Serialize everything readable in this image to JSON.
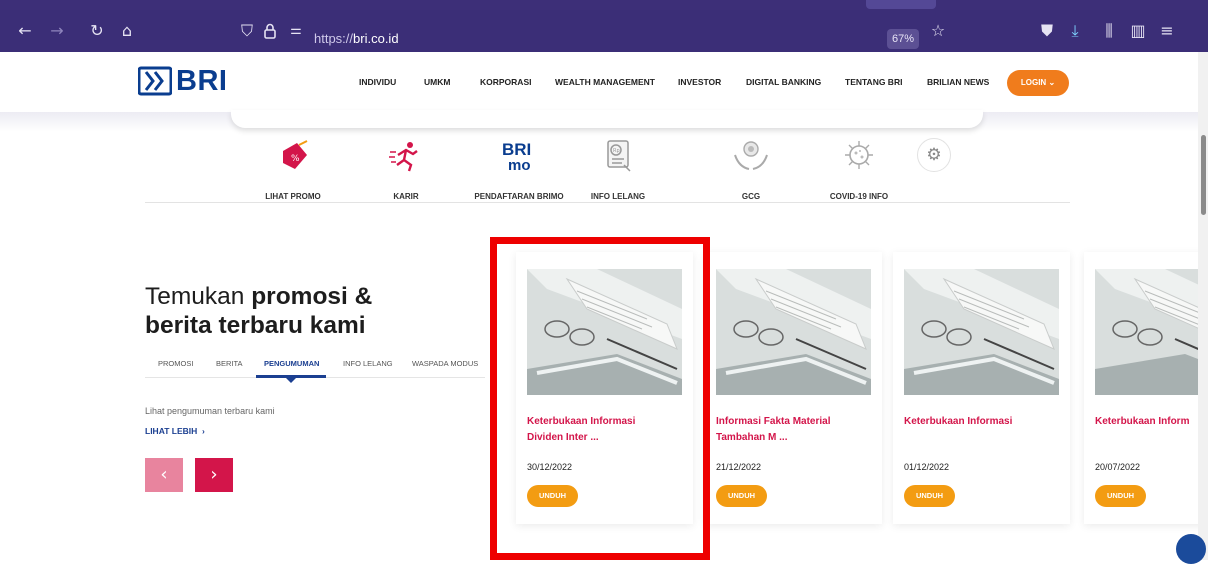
{
  "browser": {
    "url_prefix": "https://",
    "url_domain": "bri.co.id",
    "zoom": "67%",
    "icons": [
      "back-arrow-icon",
      "forward-arrow-icon",
      "reload-icon",
      "home-icon",
      "shield-icon",
      "lock-icon",
      "permissions-icon",
      "star-icon",
      "pocket-icon",
      "download-icon",
      "library-icon",
      "sidebar-icon",
      "menu-icon"
    ]
  },
  "header": {
    "logo_text": "BRI",
    "nav": [
      "INDIVIDU",
      "UMKM",
      "KORPORASI",
      "WEALTH MANAGEMENT",
      "INVESTOR",
      "DIGITAL BANKING",
      "TENTANG BRI",
      "BRILIAN NEWS"
    ],
    "login_label": "LOGIN"
  },
  "quick_menu": [
    {
      "label": "LIHAT PROMO",
      "icon": "promo-tag-icon"
    },
    {
      "label": "KARIR",
      "icon": "karir-runner-icon"
    },
    {
      "label": "PENDAFTARAN BRIMO",
      "icon": "brimo-logo-icon"
    },
    {
      "label": "INFO LELANG",
      "icon": "lelang-document-icon"
    },
    {
      "label": "GCG",
      "icon": "gcg-hands-icon"
    },
    {
      "label": "COVID-19 INFO",
      "icon": "covid-virus-icon"
    }
  ],
  "promo_section": {
    "heading_line1_normal": "Temukan ",
    "heading_line1_bold": "promosi &",
    "heading_line2": "berita terbaru kami",
    "tabs": [
      "PROMOSI",
      "BERITA",
      "PENGUMUMAN",
      "INFO LELANG",
      "WASPADA MODUS"
    ],
    "active_tab": "PENGUMUMAN",
    "subtext": "Lihat pengumuman terbaru kami",
    "more_link": "LIHAT LEBIH",
    "prev_arrow": "‹",
    "next_arrow": "›"
  },
  "cards": [
    {
      "title_line1": "Keterbukaan Informasi",
      "title_line2": "Dividen Inter ...",
      "date": "30/12/2022",
      "button": "UNDUH"
    },
    {
      "title_line1": "Informasi Fakta Material",
      "title_line2": "Tambahan M ...",
      "date": "21/12/2022",
      "button": "UNDUH"
    },
    {
      "title_line1": "Keterbukaan Informasi",
      "title_line2": "",
      "date": "01/12/2022",
      "button": "UNDUH"
    },
    {
      "title_line1": "Keterbukaan Inform",
      "title_line2": "",
      "date": "20/07/2022",
      "button": "UNDUH"
    }
  ],
  "colors": {
    "brand_blue": "#0a3d8f",
    "accent_red": "#d3154a",
    "accent_orange": "#f39c12",
    "highlight": "#ee0000"
  }
}
